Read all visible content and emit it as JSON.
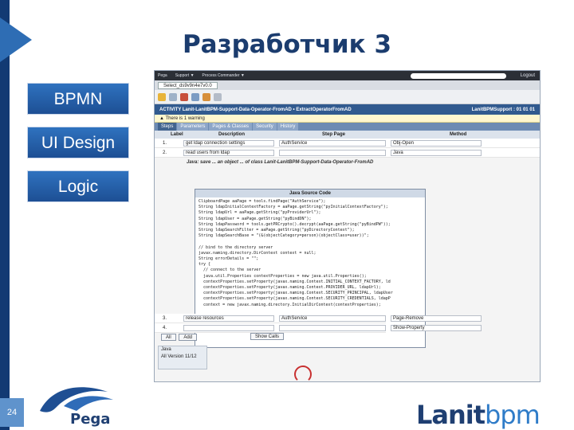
{
  "slide": {
    "title": "Разработчик 3",
    "nav": [
      "BPMN",
      "UI Design",
      "Logic"
    ],
    "slide_number": "24"
  },
  "screenshot": {
    "top_menu": [
      "Pega",
      "Support ▼",
      "Process Commander ▼"
    ],
    "logout": "Logout",
    "tab_label": "Select_ds9v9n4e7v0.0",
    "rule_title": "ACTIVITY Lanit-LanitBPM-Support-Data-Operator-FromAD • ExtractOperatorFromAD",
    "rule_right": "LanitBPMSupport : 01 01 01",
    "warning": "▲ There is 1 warning",
    "subtabs": [
      "Steps",
      "Parameters",
      "Pages & Classes",
      "Security",
      "History"
    ],
    "grid_headers": [
      "Label",
      "Description",
      "Step Page",
      "Method"
    ],
    "rows": [
      {
        "num": "1.",
        "desc": "get ldap connection settings",
        "page": "AuthService",
        "method": "Obj-Open"
      },
      {
        "num": "2.",
        "desc": "read users from ldap",
        "page": "",
        "method": "Java"
      }
    ],
    "note": "Java: save ... an object ... of class Lanit-LanitBPM-Support-Data-Operator-FromAD",
    "code_title": "Java Source Code",
    "code_lines": [
      "ClipboardPage aaPage = tools.findPage(\"AuthService\");",
      "String ldapInitialContextFactory = aaPage.getString(\"pyInitialContextFactory\");",
      "String ldapUrl = aaPage.getString(\"pyProviderUrl\");",
      "String ldapUser = aaPage.getString(\"pyBindDN\");",
      "String ldapPassword = tools.getPRCrypto().decrypt(aaPage.getString(\"pyBindPW\"));",
      "String ldapSearchFilter = aaPage.getString(\"pyDirectoryContext\");",
      "String ldapSearchBase = \"(&(objectCategory=person)(objectClass=user))\";",
      "",
      "// bind to the directory server",
      "javax.naming.directory.DirContext context = null;",
      "String errorDetails = \"\";",
      "try {",
      "  // connect to the server",
      "  java.util.Properties contextProperties = new java.util.Properties();",
      "  contextProperties.setProperty(javax.naming.Context.INITIAL_CONTEXT_FACTORY, ld",
      "  contextProperties.setProperty(javax.naming.Context.PROVIDER_URL, ldapUrl);",
      "  contextProperties.setProperty(javax.naming.Context.SECURITY_PRINCIPAL, ldapUser",
      "  contextProperties.setProperty(javax.naming.Context.SECURITY_CREDENTIALS, ldapP",
      "  context = new javax.naming.directory.InitialDirContext(contextProperties);"
    ],
    "rows_bottom": [
      {
        "num": "3.",
        "desc": "release resources",
        "page": "AuthService",
        "method": "Page-Remove"
      },
      {
        "num": "4.",
        "desc": "",
        "page": "",
        "method": "Show-Property"
      }
    ],
    "buttons": [
      "All",
      "Add"
    ],
    "show_calls": "Show Calls",
    "left_panel": [
      "Java",
      "All Version  11/12"
    ]
  },
  "logos": {
    "pega": "Pega",
    "lanit_a": "Lanit",
    "lanit_b": "bpm"
  },
  "colors": {
    "title": "#1b3c6e",
    "nav_button": "#2f72bf",
    "left_bar": "#123a73"
  }
}
